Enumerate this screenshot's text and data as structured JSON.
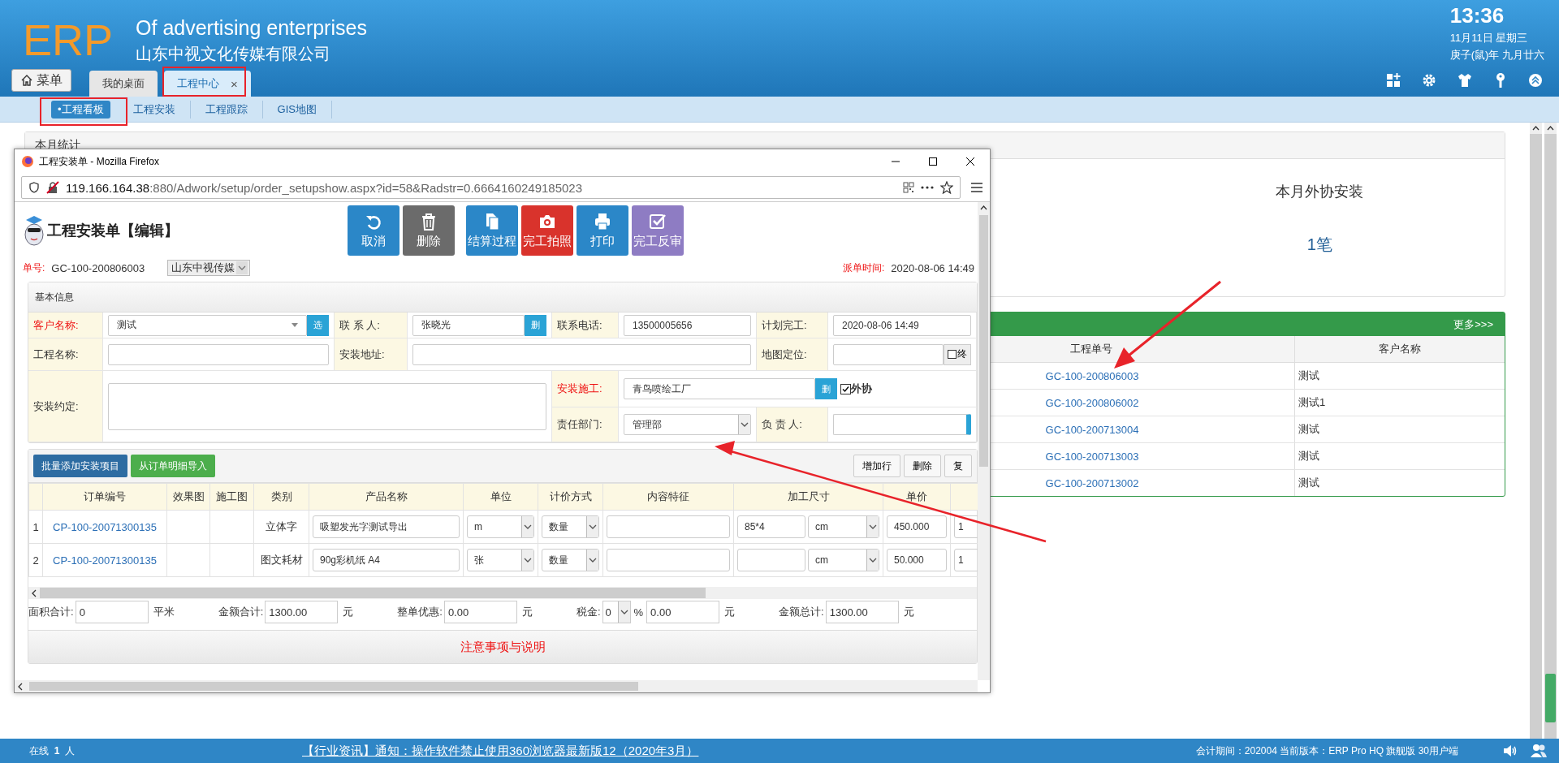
{
  "header": {
    "logo": "ERP",
    "tagline": "Of advertising enterprises",
    "company": "山东中视文化传媒有限公司",
    "time": "13:36",
    "date": "11月11日 星期三",
    "lunar_date": "庚子(鼠)年 九月廿六",
    "menu_button": "菜单"
  },
  "tabs": [
    {
      "label": "我的桌面",
      "selected": false,
      "closable": false
    },
    {
      "label": "工程中心",
      "selected": true,
      "closable": true,
      "close": "×"
    }
  ],
  "subnav": [
    {
      "label": "•工程看板",
      "selected": true
    },
    {
      "label": "工程安装",
      "selected": false
    },
    {
      "label": "工程跟踪",
      "selected": false
    },
    {
      "label": "GIS地图",
      "selected": false
    }
  ],
  "stats_card": {
    "title": "本月统计",
    "item": {
      "label": "本月外协安装",
      "value": "1笔"
    }
  },
  "orders_panel": {
    "more_link": "更多>>>",
    "columns": [
      "工程单号",
      "客户名称"
    ],
    "rows": [
      {
        "order_no": "GC-100-200806003",
        "customer": "测试"
      },
      {
        "order_no": "GC-100-200806002",
        "customer": "测试1"
      },
      {
        "order_no": "GC-100-200713004",
        "customer": "测试"
      },
      {
        "order_no": "GC-100-200713003",
        "customer": "测试"
      },
      {
        "order_no": "GC-100-200713002",
        "customer": "测试"
      }
    ]
  },
  "popup": {
    "title": "工程安装单 - Mozilla Firefox",
    "url_host": "119.166.164.38",
    "url_rest": ":880/Adwork/setup/order_setupshow.aspx?id=58&Radstr=0.6664160249185023",
    "form_title": "工程安装单【编辑】",
    "toolbar": [
      {
        "label": "取消",
        "kind": "undo",
        "color": "#2b87c8"
      },
      {
        "label": "删除",
        "kind": "trash",
        "color": "#6b6b6b"
      },
      {
        "label": "结算过程",
        "kind": "document",
        "color": "#2b87c8"
      },
      {
        "label": "完工拍照",
        "kind": "camera",
        "color": "#d9332c"
      },
      {
        "label": "打印",
        "kind": "printer",
        "color": "#2b87c8"
      },
      {
        "label": "完工反审",
        "kind": "check",
        "color": "#8e7cc3"
      }
    ],
    "order_no_label": "单号:",
    "order_no": "GC-100-200806003",
    "company_select": "山东中视传媒",
    "dispatch_label": "派单时间:",
    "dispatch_time": "2020-08-06 14:49",
    "basic_info": {
      "title": "基本信息",
      "customer": {
        "label": "客户名称:",
        "required": true,
        "value": "测试",
        "button": "选"
      },
      "contact": {
        "label": "联 系 人:",
        "required": false,
        "value": "张晓光",
        "button": "删"
      },
      "phone": {
        "label": "联系电话:",
        "required": false,
        "value": "13500005656"
      },
      "planned": {
        "label": "计划完工:",
        "required": false,
        "value": "2020-08-06 14:49"
      },
      "project_name": {
        "label": "工程名称:",
        "required": false
      },
      "address": {
        "label": "安装地址:",
        "required": false
      },
      "map": {
        "label": "地图定位:",
        "required": false,
        "button": "终"
      },
      "agreement": {
        "label": "安装约定:",
        "required": false
      },
      "installer": {
        "label": "安装施工:",
        "required": true,
        "value": "青鸟喷绘工厂",
        "button": "删",
        "outsourced_label": "外协",
        "outsourced": true
      },
      "department": {
        "label": "责任部门:",
        "required": false,
        "value": "管理部"
      },
      "manager": {
        "label": "负 责 人:",
        "required": false
      }
    },
    "items": {
      "buttons": [
        {
          "label": "批量添加安装项目",
          "color": "#2d6ca2"
        },
        {
          "label": "从订单明细导入",
          "color": "#4cae4c"
        }
      ],
      "actions": [
        "增加行",
        "删除",
        "复"
      ],
      "columns": [
        "订单编号",
        "效果图",
        "施工图",
        "类别",
        "产品名称",
        "单位",
        "计价方式",
        "内容特征",
        "加工尺寸",
        "单价"
      ],
      "rows": [
        {
          "index": "1",
          "order_no": "CP-100-20071300135",
          "category": "立体字",
          "product": "吸塑发光字测试导出",
          "unit": "m",
          "pricing": "数量",
          "size": "85*4",
          "size_unit": "cm",
          "price": "450.000",
          "column_12": "1"
        },
        {
          "index": "2",
          "order_no": "CP-100-20071300135",
          "category": "图文耗材",
          "product": "90g彩机纸 A4",
          "unit": "张",
          "pricing": "数量",
          "size_unit": "cm",
          "price": "50.000",
          "column_12": "1"
        }
      ]
    },
    "totals": {
      "area_label": "面积合计:",
      "area": "0",
      "area_unit": "平米",
      "amount_label": "金额合计:",
      "amount": "1300.00",
      "amount_unit": "元",
      "discount_label": "整单优惠:",
      "discount": "0.00",
      "discount_unit": "元",
      "tax_label": "税金:",
      "tax_rate": "0",
      "tax_percent": "%",
      "tax": "0.00",
      "tax_unit": "元",
      "total_label": "金额总计:",
      "total": "1300.00",
      "total_unit": "元"
    },
    "notes_title": "注意事项与说明"
  },
  "footer": {
    "online_label": "在线",
    "online_count": "1",
    "online_unit": "人",
    "notice": "【行业资讯】通知：操作软件禁止使用360浏览器最新版12（2020年3月）",
    "info": "会计期间：202004 当前版本：ERP Pro HQ 旗舰版 30用户端"
  }
}
